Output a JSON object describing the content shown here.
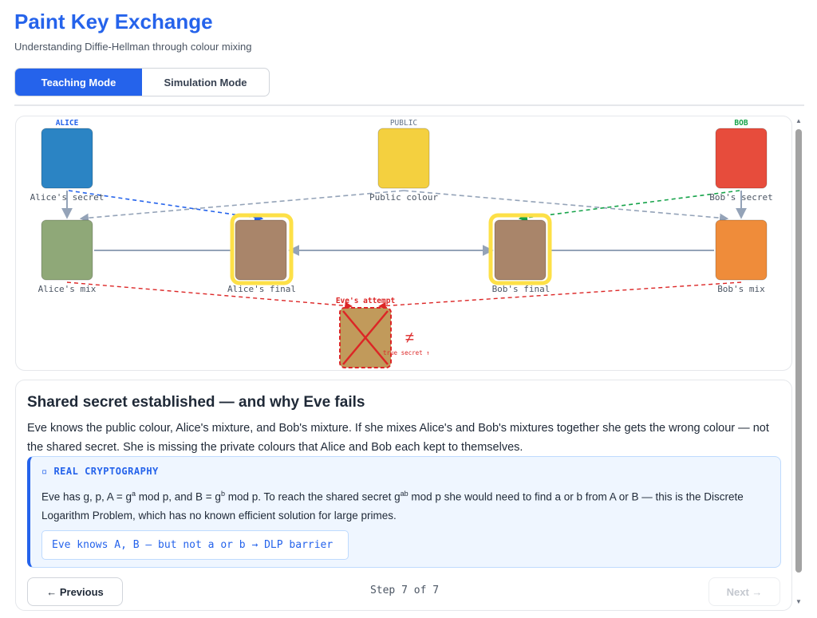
{
  "app": {
    "title": "Paint Key Exchange",
    "subtitle": "Understanding Diffie-Hellman through colour mixing"
  },
  "mode_tabs": [
    {
      "label": "Teaching Mode",
      "active": true
    },
    {
      "label": "Simulation Mode",
      "active": false
    }
  ],
  "diagram": {
    "headers": {
      "alice": "ALICE",
      "public": "PUBLIC",
      "bob": "BOB"
    },
    "paints": {
      "alice_secret": {
        "label": "Alice's secret",
        "color": "#2b84c4"
      },
      "public_colour": {
        "label": "Public colour",
        "color": "#f4d03f"
      },
      "bob_secret": {
        "label": "Bob's secret",
        "color": "#e74c3c"
      },
      "alice_mix": {
        "label": "Alice's mix",
        "color": "#8fa878"
      },
      "alice_final": {
        "label": "Alice's final",
        "color": "#a9856a"
      },
      "bob_final": {
        "label": "Bob's final",
        "color": "#a9856a"
      },
      "bob_mix": {
        "label": "Bob's mix",
        "color": "#ef8c3a"
      },
      "eve_attempt": {
        "label": "Eve's attempt",
        "color": "#c19a5b"
      }
    },
    "not_equal": "≠",
    "true_secret_note": "true secret ↑",
    "colors": {
      "alice": "#2563eb",
      "bob": "#16a34a",
      "eve": "#dc2626",
      "public_arrow": "#94a3b8",
      "highlight": "#fde047"
    }
  },
  "explanation": {
    "title": "Shared secret established — and why Eve fails",
    "body": "Eve knows the public colour, Alice's mixture, and Bob's mixture. If she mixes Alice's and Bob's mixtures together she gets the wrong colour — not the shared secret. She is missing the private colours that Alice and Bob each kept to themselves.",
    "crypto": {
      "heading": "▫ REAL CRYPTOGRAPHY",
      "text_prefix": "Eve has g, p, A = g",
      "text_sup_a": "a",
      "text_mid1": " mod p, and B = g",
      "text_sup_b": "b",
      "text_mid2": " mod p. To reach the shared secret g",
      "text_sup_ab": "ab",
      "text_suffix": " mod p she would need to find a or b from A or B — this is the Discrete Logarithm Problem, which has no known efficient solution for large primes.",
      "code": "Eve knows A, B — but not a or b → DLP barrier"
    }
  },
  "navigation": {
    "previous_label": "← Previous",
    "next_label": "Next →",
    "step_text": "Step 7 of 7",
    "current_step": 7,
    "total_steps": 7
  }
}
